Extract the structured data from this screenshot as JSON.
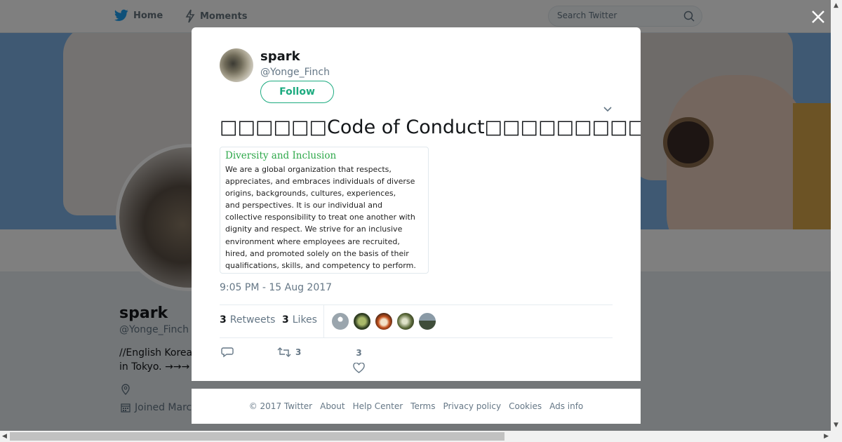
{
  "nav": {
    "home_label": "Home",
    "moments_label": "Moments",
    "search_placeholder": "Search Twitter"
  },
  "profile": {
    "name": "spark",
    "handle": "@Yonge_Finch",
    "bio": "//English Korea\nin Tokyo. →→→",
    "joined": "Joined Marc"
  },
  "tweet": {
    "author_name": "spark",
    "author_handle": "@Yonge_Finch",
    "follow_label": "Follow",
    "text": "□□□□□□Code of Conduct□□□□□□□□□□□□□□□□□□□□□□□□□□□□□□□□□□",
    "attachment": {
      "title": "Diversity and Inclusion",
      "body": "We are a global organization that respects,\nappreciates, and embraces individuals of diverse\norigins, backgrounds, cultures, experiences,\nand perspectives. It is our individual and\ncollective responsibility to treat one another with\ndignity and respect. We strive for an inclusive\nenvironment where employees are recruited,\nhired, and promoted solely on the basis of their\nqualifications, skills, and competency to perform."
    },
    "timestamp": "9:05 PM - 15 Aug 2017",
    "retweets_count": "3",
    "retweets_label": "Retweets",
    "likes_count": "3",
    "likes_label": "Likes",
    "action_retweet_count": "3",
    "action_like_count": "3"
  },
  "footer": {
    "copyright": "© 2017 Twitter",
    "about": "About",
    "help": "Help Center",
    "terms": "Terms",
    "privacy": "Privacy policy",
    "cookies": "Cookies",
    "ads": "Ads info"
  },
  "colors": {
    "follow_accent": "#1dab80",
    "attachment_title": "#2ea84a",
    "twitter_blue": "#1da1f2"
  }
}
